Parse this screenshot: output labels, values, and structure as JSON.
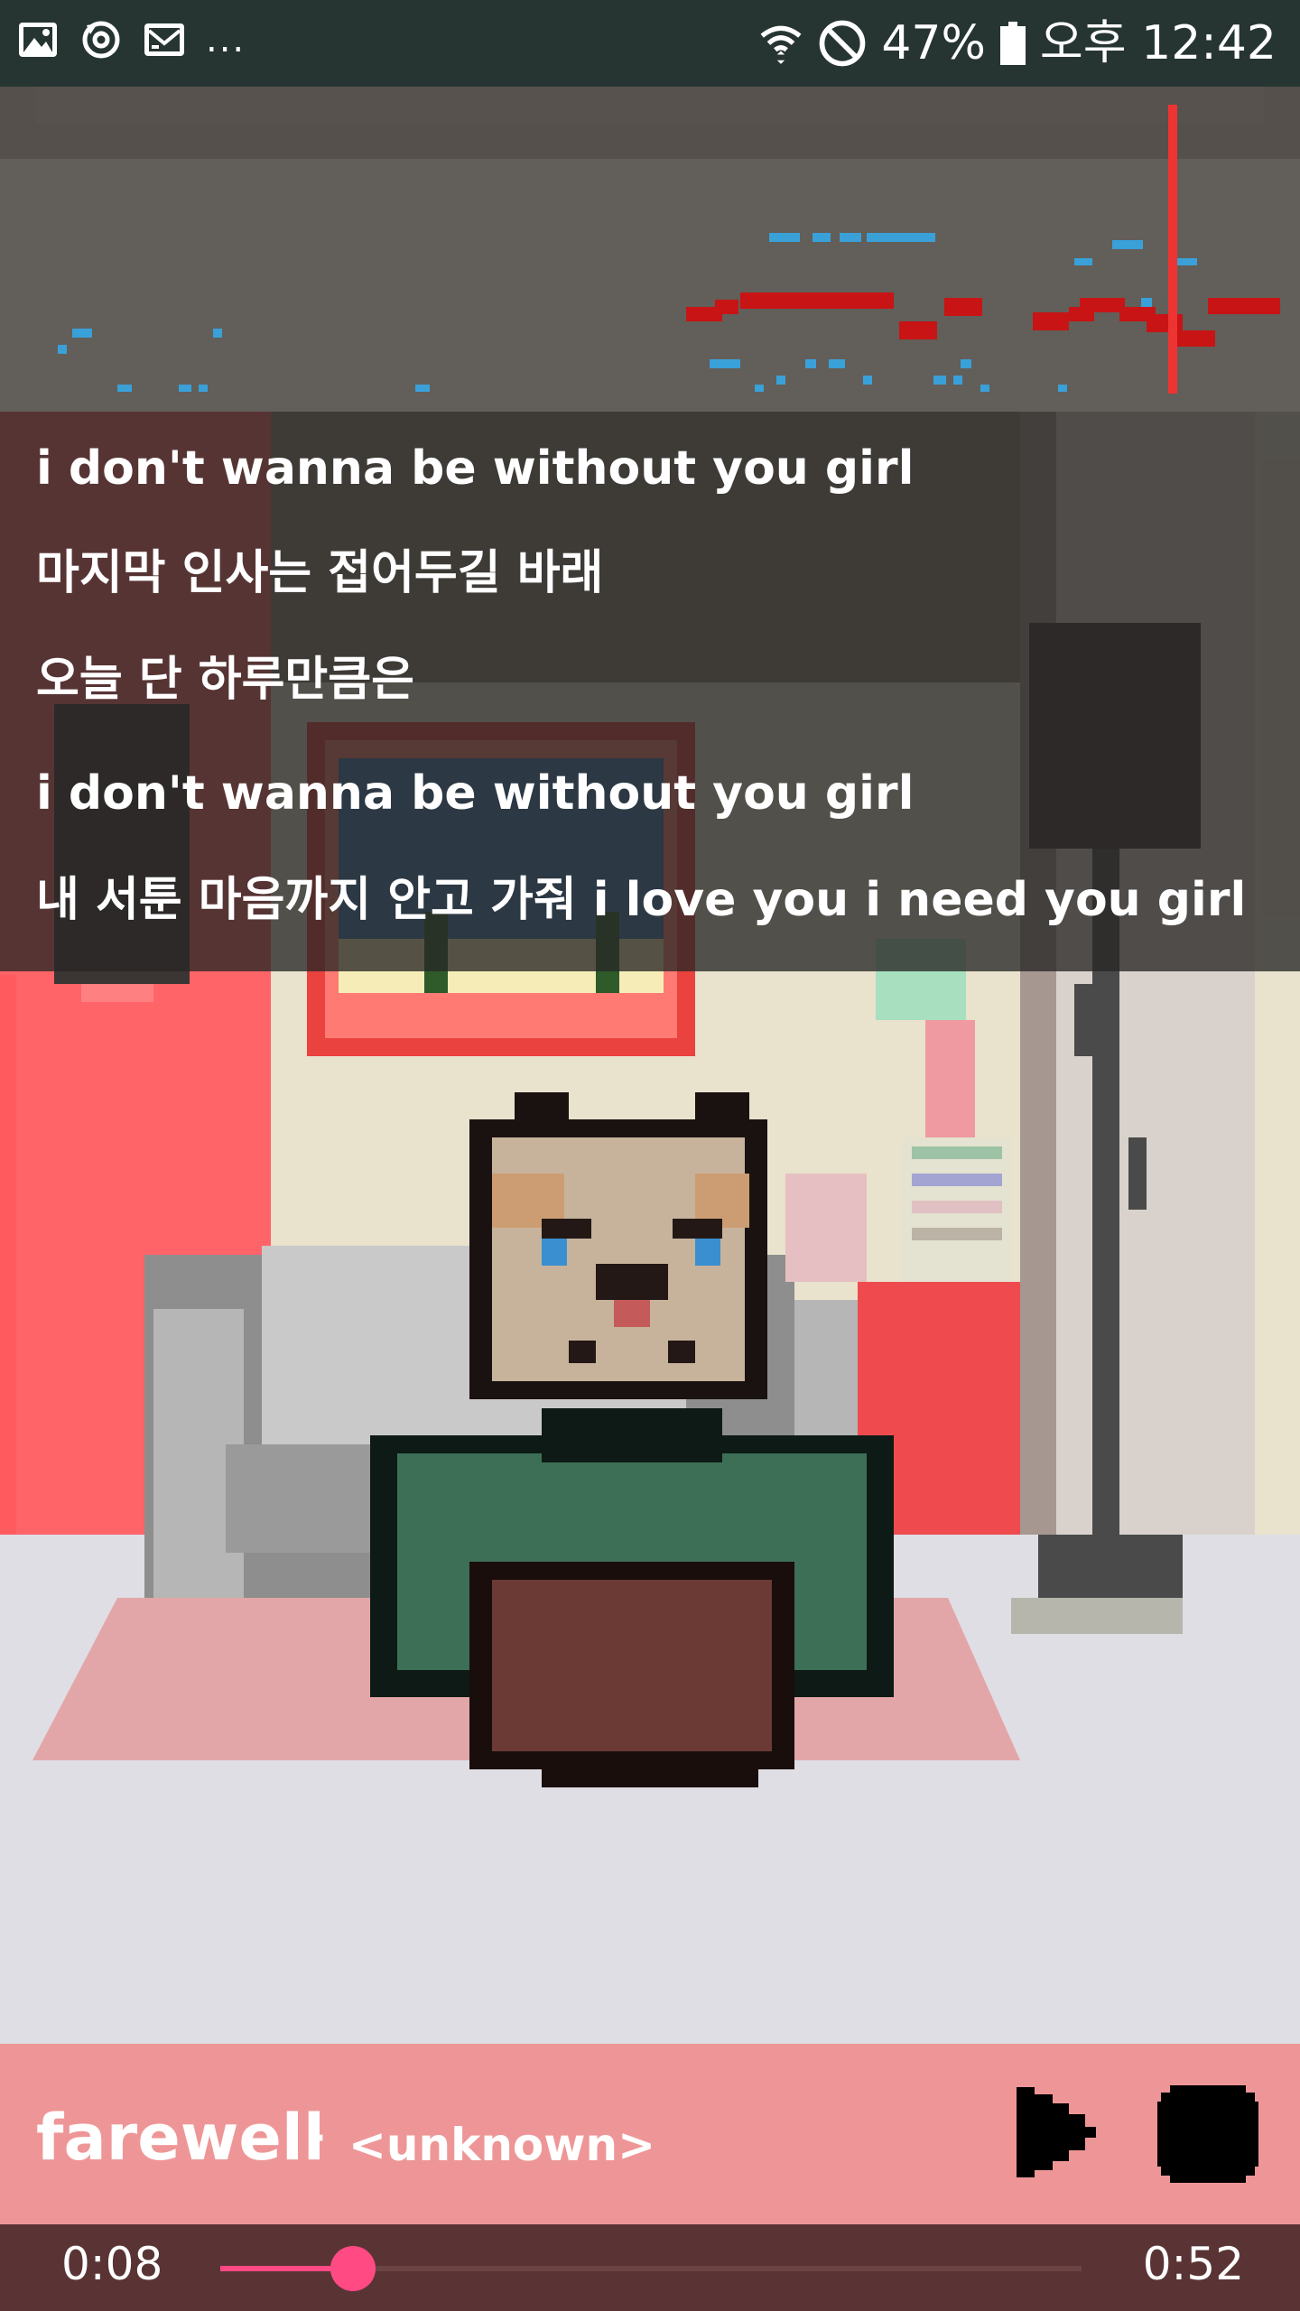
{
  "status_bar": {
    "left_icons": [
      "gallery-icon",
      "sync-icon",
      "email-icon"
    ],
    "more": "...",
    "right_icons": [
      "wifi-icon",
      "do-not-disturb-icon",
      "battery-icon"
    ],
    "battery": "47%",
    "time": "오후 12:42"
  },
  "lyrics": [
    "i don't wanna be without you girl",
    "마지막 인사는 접어두길 바래",
    "오늘 단 하루만큼은",
    "i don't wanna be without you girl",
    "내 서툰 마음까지 안고 가줘 i love you i need you girl"
  ],
  "player": {
    "title": "farewell",
    "separator": "-",
    "artist": "<unknown>",
    "play_icon": "play-icon",
    "stop_icon": "stop-icon"
  },
  "seek": {
    "current": "0:08",
    "total": "0:52",
    "progress": 0.154
  },
  "colors": {
    "status_bar": "#263532",
    "player_bar": "#ee9697",
    "seek_bar": "#5a3434",
    "accent": "#ff4a84",
    "note_red": "#c81414",
    "note_blue": "#3aa0d8"
  }
}
